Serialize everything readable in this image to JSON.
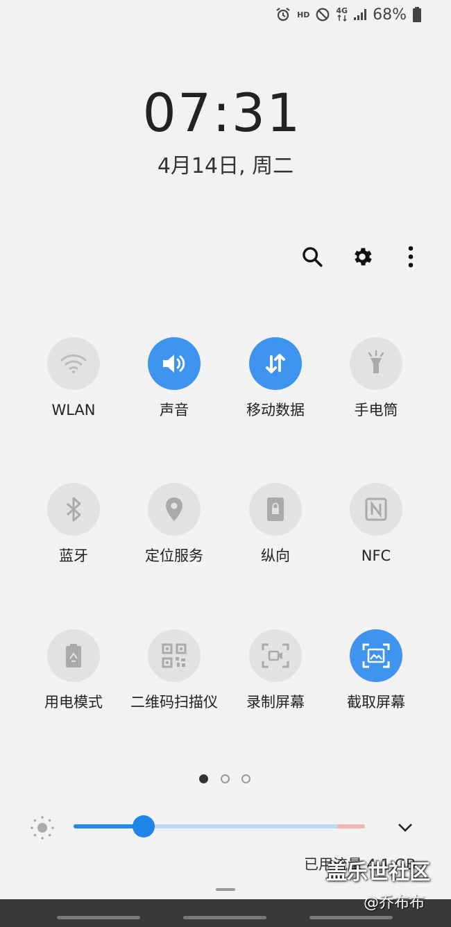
{
  "status_bar": {
    "icons": [
      "alarm-icon",
      "hd-icon",
      "do-not-disturb-icon",
      "4g-icon",
      "signal-icon",
      "battery-icon"
    ],
    "hd_label": "HD",
    "network_label": "4G",
    "battery_percent": "68%"
  },
  "clock": {
    "time": "07:31",
    "date": "4月14日, 周二"
  },
  "toolbar": {
    "icons": [
      "search-icon",
      "gear-icon",
      "more-vertical-icon"
    ]
  },
  "tiles": [
    {
      "label": "WLAN",
      "icon": "wifi-icon",
      "active": false
    },
    {
      "label": "声音",
      "icon": "sound-icon",
      "active": true
    },
    {
      "label": "移动数据",
      "icon": "mobile-data-icon",
      "active": true
    },
    {
      "label": "手电筒",
      "icon": "flashlight-icon",
      "active": false
    },
    {
      "label": "蓝牙",
      "icon": "bluetooth-icon",
      "active": false
    },
    {
      "label": "定位服务",
      "icon": "location-icon",
      "active": false
    },
    {
      "label": "纵向",
      "icon": "portrait-lock-icon",
      "active": false
    },
    {
      "label": "NFC",
      "icon": "nfc-icon",
      "active": false
    },
    {
      "label": "用电模式",
      "icon": "power-mode-icon",
      "active": false
    },
    {
      "label": "二维码扫描仪",
      "icon": "qr-scanner-icon",
      "active": false
    },
    {
      "label": "录制屏幕",
      "icon": "screen-record-icon",
      "active": false
    },
    {
      "label": "截取屏幕",
      "icon": "screenshot-icon",
      "active": true
    }
  ],
  "pagination": {
    "pages": 3,
    "current": 1
  },
  "brightness": {
    "level": 0.24,
    "icon": "sun-icon",
    "expand_icon": "chevron-down-icon"
  },
  "connection_text": "已用流量 4.1 GB",
  "watermark": {
    "main": "盖乐世社区",
    "sub": "@乔布布"
  },
  "colors": {
    "accent": "#3e94ef",
    "tile_off": "#e2e2e2",
    "background": "#f2f2f2"
  }
}
